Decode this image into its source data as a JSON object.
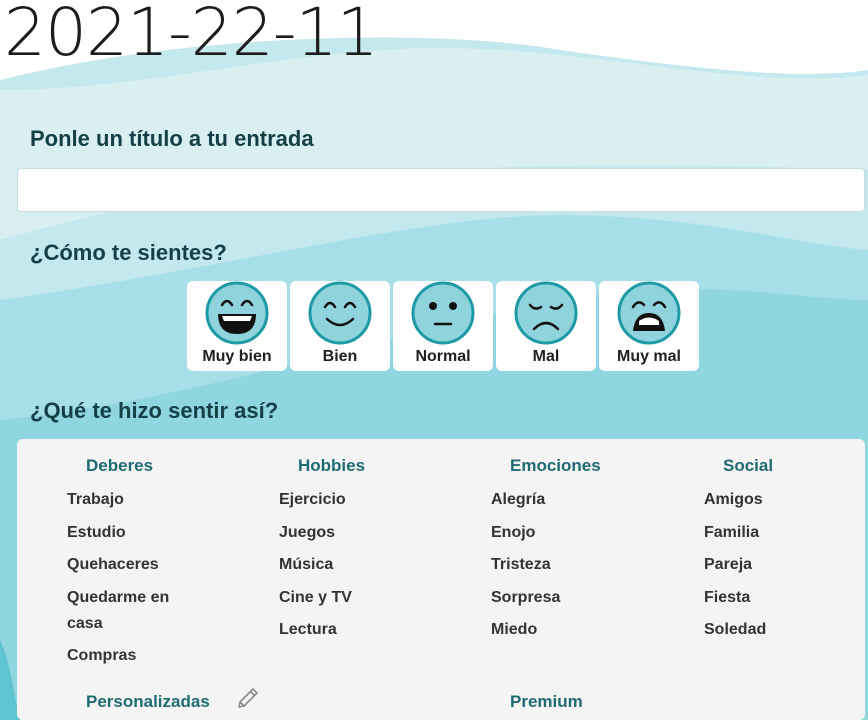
{
  "date": "2021-22-11",
  "title_section": {
    "heading": "Ponle un título a tu entrada",
    "input_value": "",
    "input_placeholder": ""
  },
  "mood_section": {
    "heading": "¿Cómo te sientes?",
    "moods": [
      {
        "label": "Muy bien",
        "icon": "very-happy-face-icon"
      },
      {
        "label": "Bien",
        "icon": "smile-face-icon"
      },
      {
        "label": "Normal",
        "icon": "neutral-face-icon"
      },
      {
        "label": "Mal",
        "icon": "sad-face-icon"
      },
      {
        "label": "Muy mal",
        "icon": "very-sad-face-icon"
      }
    ]
  },
  "reasons_section": {
    "heading": "¿Qué te hizo sentir así?",
    "categories": [
      {
        "name": "Deberes",
        "items": [
          "Trabajo",
          "Estudio",
          "Quehaceres",
          "Quedarme en casa",
          "Compras"
        ]
      },
      {
        "name": "Hobbies",
        "items": [
          "Ejercicio",
          "Juegos",
          "Música",
          "Cine y TV",
          "Lectura"
        ]
      },
      {
        "name": "Emociones",
        "items": [
          "Alegría",
          "Enojo",
          "Tristeza",
          "Sorpresa",
          "Miedo"
        ]
      },
      {
        "name": "Social",
        "items": [
          "Amigos",
          "Familia",
          "Pareja",
          "Fiesta",
          "Soledad"
        ]
      }
    ],
    "custom_label": "Personalizadas",
    "custom_icon": "pencil-icon",
    "premium_label": "Premium"
  },
  "colors": {
    "heading": "#153f46",
    "category": "#1f6b72",
    "face": "#8fd3dc",
    "face_outline": "#1e9aa6"
  }
}
